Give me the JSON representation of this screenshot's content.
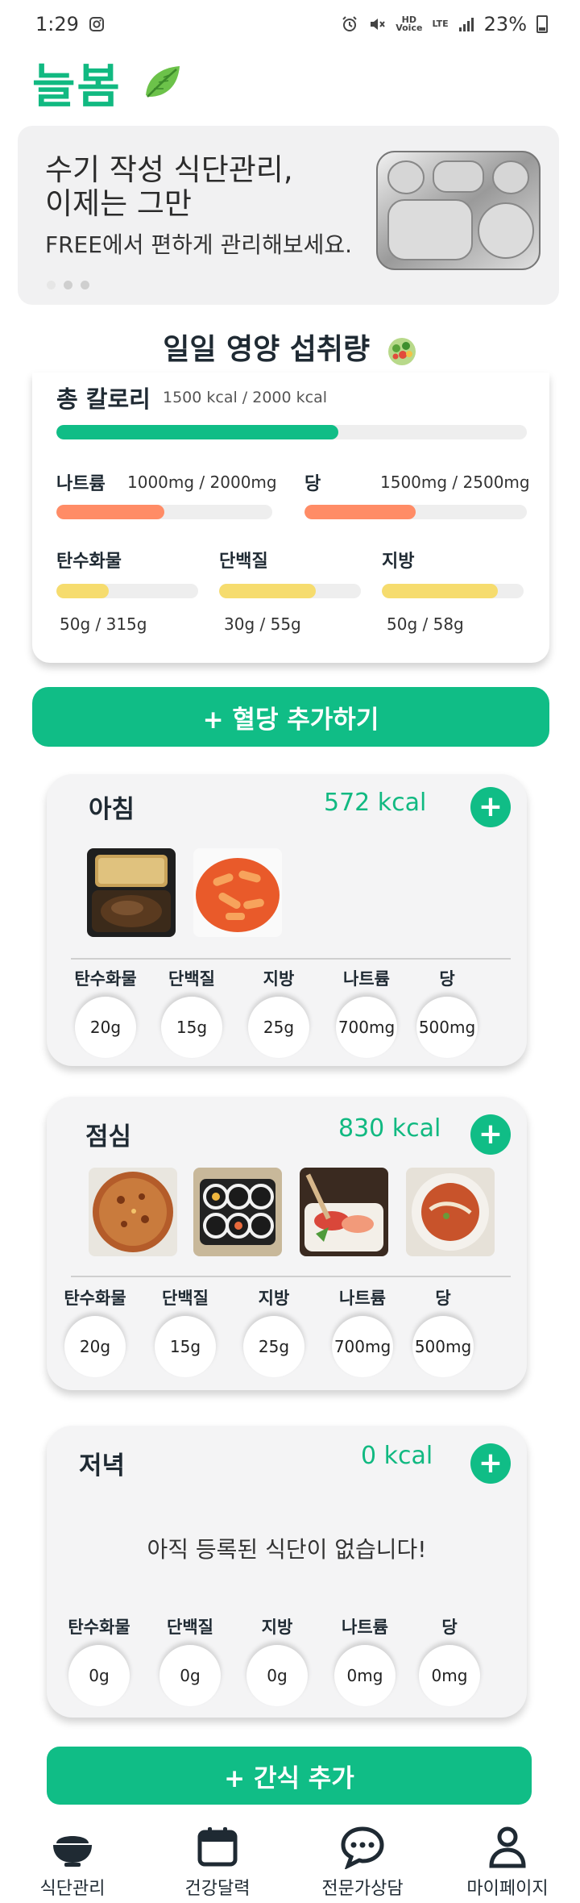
{
  "status": {
    "time": "1:29",
    "battery": "23%",
    "hd_badge": "HD\nVoice",
    "lte_badge": "LTE"
  },
  "app": {
    "logo": "늘봄"
  },
  "banner": {
    "title": "수기 작성 식단관리,\n이제는 그만",
    "subtitle": "FREE에서 편하게 관리해보세요."
  },
  "daily": {
    "title": "일일 영양 섭취량",
    "kcal": {
      "label": "총 칼로리",
      "value": "1500 kcal / 2000 kcal",
      "progress": 0.6
    },
    "sodium": {
      "label": "나트륨",
      "value": "1000mg / 2000mg",
      "progress": 0.5
    },
    "sugar": {
      "label": "당",
      "value": "1500mg / 2500mg",
      "progress": 0.5
    },
    "carbs": {
      "label": "탄수화물",
      "value": "50g / 315g",
      "progress": 0.37
    },
    "protein": {
      "label": "단백질",
      "value": "30g / 55g",
      "progress": 0.68
    },
    "fat": {
      "label": "지방",
      "value": "50g / 58g",
      "progress": 0.82
    }
  },
  "buttons": {
    "add_blood_sugar": "+ 혈당 추가하기",
    "add_snack": "+ 간식 추가",
    "plus": "+"
  },
  "meals": {
    "breakfast": {
      "name": "아침",
      "kcal": "572 kcal",
      "nutrients": [
        {
          "label": "탄수화물",
          "value": "20g"
        },
        {
          "label": "단백질",
          "value": "15g"
        },
        {
          "label": "지방",
          "value": "25g"
        },
        {
          "label": "나트륨",
          "value": "700mg"
        },
        {
          "label": "당",
          "value": "500mg"
        }
      ]
    },
    "lunch": {
      "name": "점심",
      "kcal": "830 kcal",
      "nutrients": [
        {
          "label": "탄수화물",
          "value": "20g"
        },
        {
          "label": "단백질",
          "value": "15g"
        },
        {
          "label": "지방",
          "value": "25g"
        },
        {
          "label": "나트륨",
          "value": "700mg"
        },
        {
          "label": "당",
          "value": "500mg"
        }
      ]
    },
    "dinner": {
      "name": "저녁",
      "kcal": "0 kcal",
      "empty": "아직 등록된 식단이 없습니다!",
      "nutrients": [
        {
          "label": "탄수화물",
          "value": "0g"
        },
        {
          "label": "단백질",
          "value": "0g"
        },
        {
          "label": "지방",
          "value": "0g"
        },
        {
          "label": "나트륨",
          "value": "0mg"
        },
        {
          "label": "당",
          "value": "0mg"
        }
      ]
    }
  },
  "nav": [
    {
      "label": "식단관리",
      "icon": "rice-bowl-icon"
    },
    {
      "label": "건강달력",
      "icon": "calendar-icon"
    },
    {
      "label": "전문가상담",
      "icon": "chat-bubble-icon"
    },
    {
      "label": "마이페이지",
      "icon": "person-icon"
    }
  ],
  "colors": {
    "accent": "#10bd86",
    "orange": "#ff8c66",
    "yellow": "#f6dc6e"
  }
}
